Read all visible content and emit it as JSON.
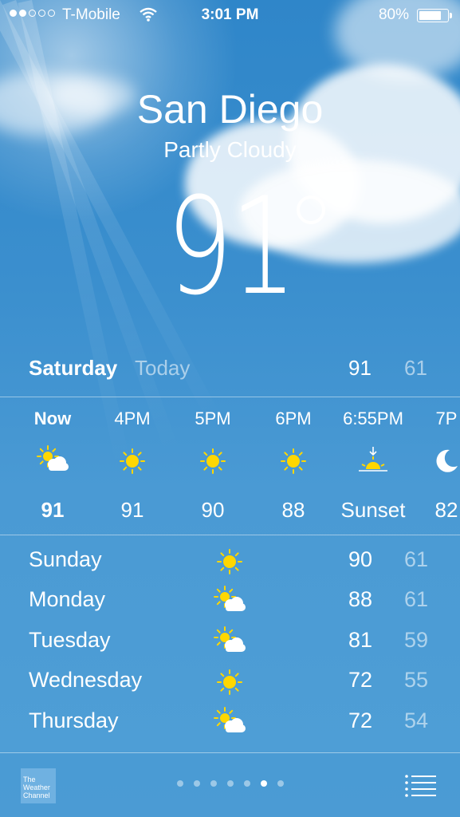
{
  "status_bar": {
    "signal_dots_filled": 2,
    "signal_dots_total": 5,
    "carrier": "T-Mobile",
    "time": "3:01 PM",
    "battery_percent_text": "80%",
    "battery_level": 0.8
  },
  "location": {
    "city": "San Diego",
    "condition": "Partly Cloudy",
    "temperature": "91"
  },
  "today": {
    "day": "Saturday",
    "label": "Today",
    "high": "91",
    "low": "61"
  },
  "hourly": [
    {
      "time": "Now",
      "icon": "partly-cloudy-icon",
      "value": "91",
      "bold": true
    },
    {
      "time": "4PM",
      "icon": "sun-icon",
      "value": "91"
    },
    {
      "time": "5PM",
      "icon": "sun-icon",
      "value": "90"
    },
    {
      "time": "6PM",
      "icon": "sun-icon",
      "value": "88"
    },
    {
      "time": "6:55PM",
      "icon": "sunset-icon",
      "value": "Sunset"
    },
    {
      "time": "7P",
      "icon": "moon-icon",
      "value": "82"
    }
  ],
  "daily": [
    {
      "day": "Sunday",
      "icon": "sun-icon",
      "high": "90",
      "low": "61"
    },
    {
      "day": "Monday",
      "icon": "partly-cloudy-icon",
      "high": "88",
      "low": "61"
    },
    {
      "day": "Tuesday",
      "icon": "partly-cloudy-icon",
      "high": "81",
      "low": "59"
    },
    {
      "day": "Wednesday",
      "icon": "sun-icon",
      "high": "72",
      "low": "55"
    },
    {
      "day": "Thursday",
      "icon": "partly-cloudy-icon",
      "high": "72",
      "low": "54"
    }
  ],
  "footer": {
    "logo_text": "The Weather Channel",
    "page_count": 7,
    "active_page": 6
  },
  "colors": {
    "sky": "#3b8fce",
    "sun": "#ffd700",
    "secondary_text": "rgba(255,255,255,0.55)"
  }
}
